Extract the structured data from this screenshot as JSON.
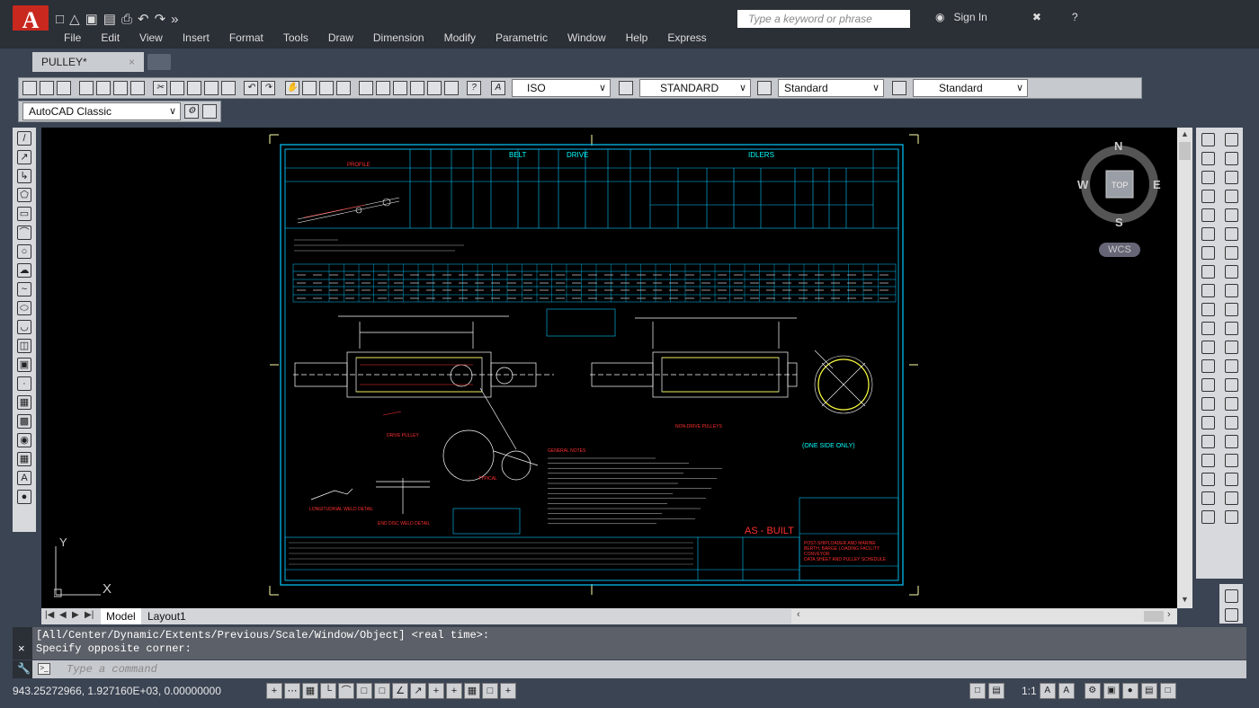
{
  "app": {
    "logo_letter": "A"
  },
  "search": {
    "placeholder": "Type a keyword or phrase"
  },
  "account": {
    "signin": "Sign In"
  },
  "menu": [
    "File",
    "Edit",
    "View",
    "Insert",
    "Format",
    "Tools",
    "Draw",
    "Dimension",
    "Modify",
    "Parametric",
    "Window",
    "Help",
    "Express"
  ],
  "document_tab": {
    "title": "PULLEY*"
  },
  "toolbar": {
    "text_style": "ISO",
    "dim_style": "STANDARD",
    "table_style": "Standard",
    "mleader_style": "Standard"
  },
  "workspace": {
    "current": "AutoCAD Classic"
  },
  "viewcube": {
    "face": "TOP",
    "north": "N",
    "south": "S",
    "east": "E",
    "west": "W",
    "ucs_name": "WCS"
  },
  "ucs_icon": {
    "x_label": "X",
    "y_label": "Y"
  },
  "layout_tabs": [
    "Model",
    "Layout1"
  ],
  "command_history": [
    "[All/Center/Dynamic/Extents/Previous/Scale/Window/Object] <real time>:",
    "Specify opposite corner:"
  ],
  "command_input": {
    "placeholder": "Type a command"
  },
  "status": {
    "coordinates": "943.25272966, 1.927160E+03, 0.00000000",
    "annotation_scale": "1:1"
  },
  "drawing": {
    "header_belt": "BELT",
    "header_drive": "DRIVE",
    "header_idlers": "IDLERS",
    "header_profile": "PROFILE",
    "stamp": "AS - BUILT",
    "note_one_side": "(ONE SIDE ONLY)",
    "title_line1": "POST-SHIPLOADER AND MARINE",
    "title_line2": "BERTH, BARGE LOADING FACILITY",
    "title_line3": "CONVEYOR",
    "title_line4": "DATA SHEET AND PULLEY SCHEDULE",
    "label_drive_pulley": "DRIVE PULLEY",
    "label_non_drive": "NON-DRIVE PULLEYS",
    "label_general_notes": "GENERAL NOTES",
    "label_longitudinal_weld": "LONGITUDINAL WELD DETAIL",
    "label_end_disc_weld": "END DISC WELD DETAIL",
    "label_typical": "TYPICAL"
  },
  "colors": {
    "canvas": "#000000",
    "frame": "#ffffff",
    "border": "#00c8ff",
    "annotation": "#ff3030",
    "accent": "#ffff40"
  }
}
